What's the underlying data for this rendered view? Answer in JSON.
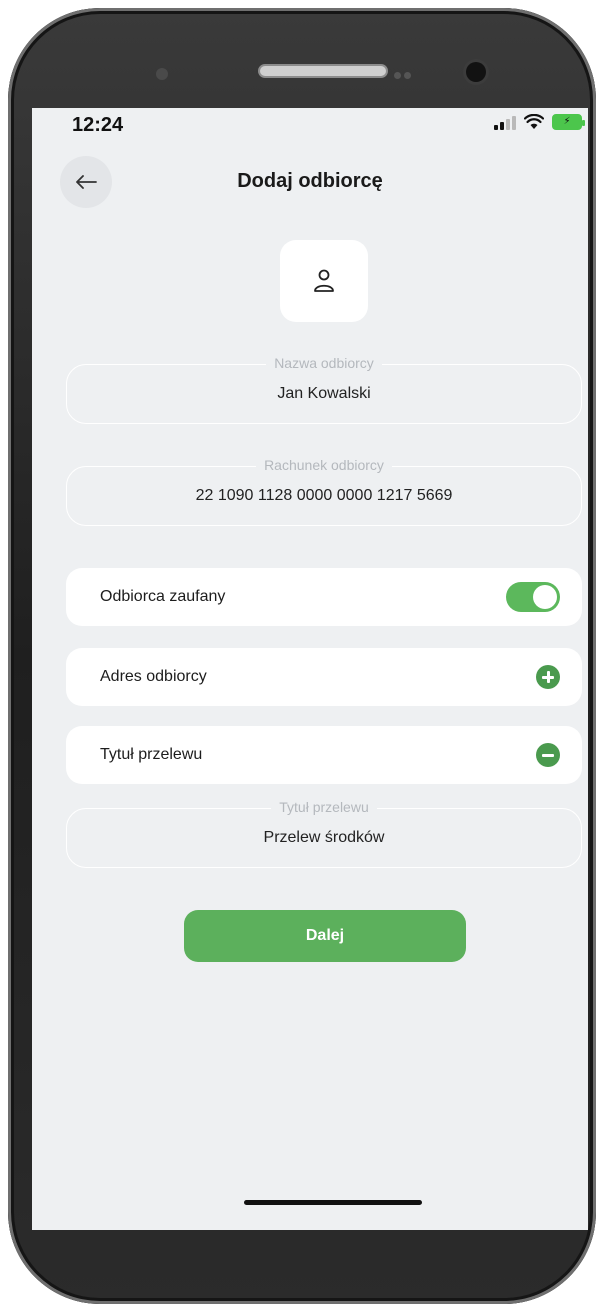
{
  "status_bar": {
    "time": "12:24",
    "battery_color": "#4cc64c"
  },
  "header": {
    "back_icon": "arrow-left-icon",
    "title": "Dodaj odbiorcę"
  },
  "avatar": {
    "icon": "person-icon"
  },
  "fields": {
    "name": {
      "label": "Nazwa odbiorcy",
      "value": "Jan Kowalski"
    },
    "account": {
      "label": "Rachunek odbiorcy",
      "value": "22 1090 1128 0000 0000 1217 5669"
    },
    "transfer_title": {
      "label": "Tytuł przelewu",
      "value": "Przelew środków"
    }
  },
  "options": {
    "trusted": {
      "label": "Odbiorca zaufany",
      "checked": true
    },
    "address": {
      "label": "Adres odbiorcy",
      "icon": "plus-circle-icon"
    },
    "title": {
      "label": "Tytuł przelewu",
      "icon": "minus-circle-icon"
    }
  },
  "actions": {
    "next_label": "Dalej"
  },
  "colors": {
    "accent": "#5cb05c",
    "background": "#eef0f2"
  }
}
